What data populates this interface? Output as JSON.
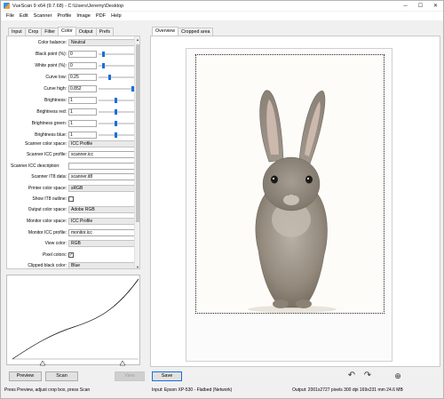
{
  "window": {
    "title": "VueScan 9 x64 (9.7.68) - C:\\Users\\Jeremy\\Desktop"
  },
  "menu": [
    "File",
    "Edit",
    "Scanner",
    "Profile",
    "Image",
    "PDF",
    "Help"
  ],
  "left_tabs": [
    "Input",
    "Crop",
    "Filter",
    "Color",
    "Output",
    "Prefs"
  ],
  "active_left_tab": "Color",
  "right_tabs": [
    "Overview",
    "Cropped area"
  ],
  "active_right_tab": "Overview",
  "settings": {
    "color_balance": {
      "label": "Color balance:",
      "value": "Neutral"
    },
    "black_point": {
      "label": "Black point (%):",
      "value": "0",
      "level": 0.08
    },
    "white_point": {
      "label": "White point (%):",
      "value": "0",
      "level": 0.08
    },
    "curve_low": {
      "label": "Curve low:",
      "value": "0.25",
      "level": 0.25
    },
    "curve_high": {
      "label": "Curve high:",
      "value": "0.852",
      "level": 0.85
    },
    "brightness": {
      "label": "Brightness:",
      "value": "1",
      "level": 0.4
    },
    "brightness_red": {
      "label": "Brightness red:",
      "value": "1",
      "level": 0.4
    },
    "brightness_green": {
      "label": "Brightness green:",
      "value": "1",
      "level": 0.4
    },
    "brightness_blue": {
      "label": "Brightness blue:",
      "value": "1",
      "level": 0.4
    },
    "scanner_color_space": {
      "label": "Scanner color space:",
      "value": "ICC Profile"
    },
    "scanner_icc_profile": {
      "label": "Scanner ICC profile:",
      "value": "scanner.icc"
    },
    "scanner_icc_description": {
      "label": "Scanner ICC description:",
      "value": ""
    },
    "scanner_it8_data": {
      "label": "Scanner IT8 data:",
      "value": "scanner.it8"
    },
    "printer_color_space": {
      "label": "Printer color space:",
      "value": "sRGB"
    },
    "show_it8_outline": {
      "label": "Show IT8 outline:",
      "checked": false
    },
    "output_color_space": {
      "label": "Output color space:",
      "value": "Adobe RGB"
    },
    "monitor_color_space": {
      "label": "Monitor color space:",
      "value": "ICC Profile"
    },
    "monitor_icc_profile": {
      "label": "Monitor ICC profile:",
      "value": "monitor.icc"
    },
    "view_color": {
      "label": "View color:",
      "value": "RGB"
    },
    "pixel_colors": {
      "label": "Pixel colors:",
      "checked": true,
      "mark": "✓"
    },
    "clipped_black_color": {
      "label": "Clipped black color:",
      "value": "Blue"
    }
  },
  "buttons": {
    "preview": "Preview",
    "scan": "Scan",
    "view": "View",
    "save": "Save"
  },
  "status": {
    "left": "Press Preview, adjust crop box, press Scan",
    "middle": "Input: Epson XP-530 - Flatbed (Network)",
    "right": "Output: 2001x2727 pixels 300 dpi 169x231 mm 24.6 MB"
  },
  "icons": {
    "app": "vuescan-app-icon",
    "minimize": "minimize-icon",
    "maximize": "maximize-icon",
    "close": "close-icon",
    "rotate_left": "rotate-left-icon",
    "rotate_right": "rotate-right-icon",
    "zoom": "zoom-in-icon"
  },
  "colors": {
    "accent": "#1a6fd8",
    "crop_border": "#222222"
  }
}
